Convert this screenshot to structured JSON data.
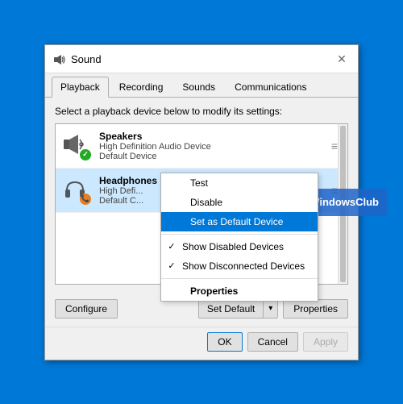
{
  "window": {
    "title": "Sound",
    "close_label": "✕"
  },
  "tabs": [
    {
      "id": "playback",
      "label": "Playback",
      "active": true
    },
    {
      "id": "recording",
      "label": "Recording",
      "active": false
    },
    {
      "id": "sounds",
      "label": "Sounds",
      "active": false
    },
    {
      "id": "communications",
      "label": "Communications",
      "active": false
    }
  ],
  "instruction": "Select a playback device below to modify its settings:",
  "devices": [
    {
      "name": "Speakers",
      "sub1": "High Definition Audio Device",
      "sub2": "Default Device",
      "type": "speaker",
      "status": "default"
    },
    {
      "name": "Headphones",
      "sub1": "High Defi...",
      "sub2": "Default C...",
      "type": "headphone",
      "status": "phone"
    }
  ],
  "context_menu": {
    "items": [
      {
        "label": "Test",
        "type": "normal"
      },
      {
        "label": "Disable",
        "type": "normal"
      },
      {
        "label": "Set as Default Device",
        "type": "highlighted"
      },
      {
        "label": "Show Disabled Devices",
        "type": "check",
        "checked": true
      },
      {
        "label": "Show Disconnected Devices",
        "type": "check",
        "checked": true
      },
      {
        "label": "Properties",
        "type": "bold"
      }
    ]
  },
  "buttons": {
    "configure": "Configure",
    "set_default": "Set Default",
    "properties": "Properties",
    "ok": "OK",
    "cancel": "Cancel",
    "apply": "Apply"
  },
  "watermark": {
    "text": "TheWindowsClub"
  }
}
